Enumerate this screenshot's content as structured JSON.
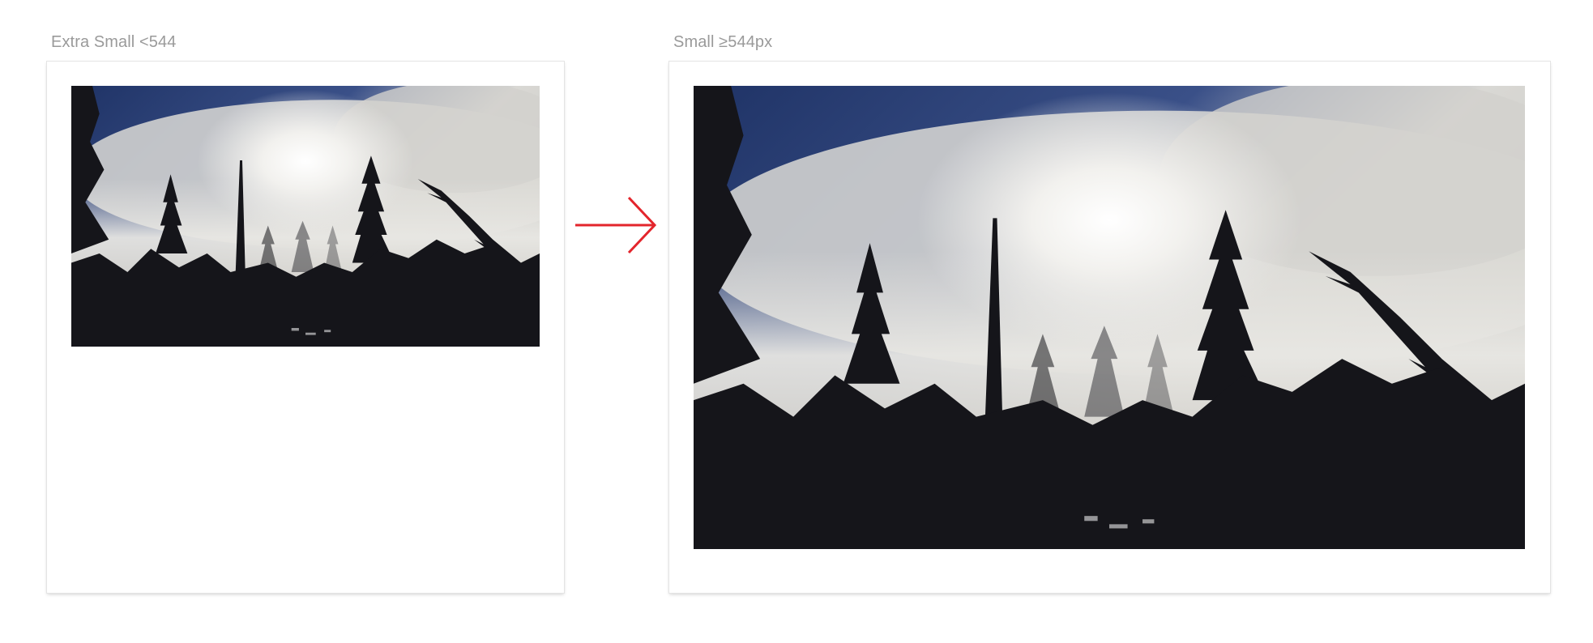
{
  "breakpoints": {
    "extra_small": {
      "label": "Extra Small <544"
    },
    "small": {
      "label": "Small ≥544px"
    }
  },
  "transition": {
    "icon": "arrow-right-icon",
    "color": "#e3252c"
  },
  "image": {
    "subject": "misty-forest-silhouette",
    "colors": {
      "sky": "#233a6e",
      "cloud": "#eceae6",
      "trees": "#15151a"
    }
  }
}
